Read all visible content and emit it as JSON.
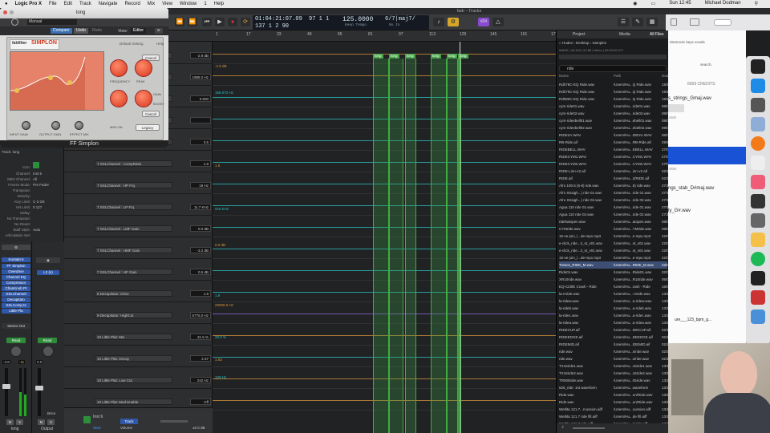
{
  "menubar": {
    "apple": "",
    "items": [
      "Logic Pro X",
      "File",
      "Edit",
      "Track",
      "Navigate",
      "Record",
      "Mix",
      "View",
      "Window",
      "1",
      "Help"
    ],
    "clock": "Sun 12:45",
    "user": "Michael Dodman"
  },
  "window_title": "fadr - Tracks",
  "transport": {
    "position": "01:04:21:07.09",
    "bars": "137  1  2  90",
    "tempo_top": "97  1  1",
    "tempo_bottom": "125.0000",
    "keep_tempo": "Keep Tempo",
    "sig": "6/7|maj7/",
    "sig2": "No In",
    "cpu": "d34",
    "time_label": "1234"
  },
  "plugin": {
    "title": "long",
    "preset": "Manual",
    "compare": "Compare",
    "undo": "Undo",
    "redo": "Redo",
    "view_label": "View:",
    "view_value": "Editor",
    "brand": "fabfilter",
    "product": "SIMPLON",
    "default_setting": "Default Setting",
    "help": "Help",
    "cancel": "Cancel",
    "frequency": "FREQUENCY",
    "peak": "PEAK",
    "gain": "GAIN",
    "boost": "BOOST",
    "input_gain": "INPUT GAIN",
    "output_gain": "OUTPUT GAIN",
    "effect_mix": "EFFECT MIX",
    "midi_on": "MIDI ON",
    "legacy": "Legacy",
    "footer_name": "FF Simplon"
  },
  "inspector": {
    "track_label": "Track:",
    "track_name": "long",
    "icon_label": "Icon:",
    "rows": [
      [
        "Channel:",
        "Inst 5"
      ],
      [
        "MIDI Channel:",
        "All"
      ],
      [
        "Freeze Mode:",
        "Pre Fader"
      ],
      [
        "Transpose:",
        ""
      ],
      [
        "Velocity:",
        ""
      ],
      [
        "Key Limit:",
        "C-2  G8"
      ],
      [
        "Vel Limit:",
        "0  127"
      ],
      [
        "Delay:",
        ""
      ],
      [
        "No Transpose:",
        ""
      ],
      [
        "No Reset:",
        ""
      ],
      [
        "Staff Style:",
        "Auto"
      ],
      [
        "Articulation Set:",
        ""
      ]
    ],
    "strip1": {
      "plugins": [
        "Kontakt 5",
        "FF Simplon",
        "Overdrive",
        "Channel EQ",
        "Compressor",
        "ChanKnob Pr",
        "SSLChannel",
        "Decapitato",
        "SSLComp.ts",
        "Little Pla"
      ],
      "output": "Stereo Out",
      "read": "Read",
      "val1": "-4.8",
      "val2": "-11",
      "m": "M",
      "s": "S",
      "name": "long"
    },
    "strip2": {
      "plugins": [
        "L2 (s)"
      ],
      "read": "Read",
      "val1": "0.0",
      "m": "M",
      "s": "S",
      "name": "Output",
      "bnce": "Bnce"
    }
  },
  "tracks": [
    {
      "name": "",
      "value": "-2.9 dB"
    },
    {
      "name": "",
      "value": "1988.2 Hz"
    },
    {
      "name": "",
      "value": "0.600"
    },
    {
      "name": "",
      "value": ""
    },
    {
      "name": "",
      "value": "3.5"
    },
    {
      "name": "7 SSLChannel : CompRatio",
      "value": "1.8"
    },
    {
      "name": "7 SSLChannel : HP Frq",
      "value": "18 Hz"
    },
    {
      "name": "7 SSLChannel : LP Frq",
      "value": "11.7 KHz"
    },
    {
      "name": "7 SSLChannel : LMF Gain",
      "value": "0.0 dB"
    },
    {
      "name": "7 SSLChannel : HMF Gain",
      "value": "-3.2 dB"
    },
    {
      "name": "7 SSLChannel : HF Gain",
      "value": "0.5 dB"
    },
    {
      "name": "8 Decapitator: Drive",
      "value": "1.8"
    },
    {
      "name": "9 Decapitator: HighCut",
      "value": "5775.0 Hz"
    },
    {
      "name": "10 Little Plat: Mix",
      "value": "31.5 %"
    },
    {
      "name": "10 Little Plat: Decay",
      "value": "2.37"
    },
    {
      "name": "10 Little Plat: Low Cut",
      "value": "242 Hz"
    },
    {
      "name": "10 Little Plat: Mod Enable",
      "value": "Off"
    }
  ],
  "bottom_track": {
    "name": "Inst 6",
    "volume": "Volume",
    "value": "±0.0 dB",
    "track_btn": "Track",
    "start": "Start"
  },
  "ruler": [
    "1",
    "17",
    "33",
    "49",
    "65",
    "81",
    "97",
    "113",
    "129",
    "145",
    "161",
    "177"
  ],
  "regions": [
    "long",
    "long",
    "long",
    "long",
    "long",
    "long"
  ],
  "lane_labels": [
    "-2.9 dB",
    "165.072 Hz",
    "1.8",
    "Out KHz",
    "0.0 dB",
    "1.8",
    "20000.0 Hz",
    "29.0 %",
    "1.63",
    "129 Hz"
  ],
  "browser": {
    "tabs": [
      "Project",
      "Media",
      "All Files"
    ],
    "path": [
      "Hudex",
      "Desktop",
      "Samples"
    ],
    "info": "WAVE | 44,100 | 24 Bit | Mono | 00:00:00.577",
    "search": "ride",
    "cols": [
      "Name",
      "Path",
      "Date"
    ],
    "rows": [
      [
        "Rd078C-EQ Ride.wav",
        "/Users/Hu...Q Ride.wav",
        "19/10/20..."
      ],
      [
        "Rd079C-EQ Ride.wav",
        "/Users/Hu...Q Ride.wav",
        "19/10/20..."
      ],
      [
        "Rd080C-EQ Ride.wav",
        "/Users/Hu...Q Ride.wav",
        "19/10/20..."
      ],
      [
        "cym-ride01.wav",
        "/Users/Hu...ride01.wav",
        "08/05/20..."
      ],
      [
        "cym-ride02.wav",
        "/Users/Hu...ride02.wav",
        "08/05/20..."
      ],
      [
        "cym-rideebell01.wav",
        "/Users/Hu...ebell01.wav",
        "08/05/20..."
      ],
      [
        "cym-rideebell02.wav",
        "/Users/Hu...ebell02.wav",
        "08/05/20..."
      ],
      [
        "RIDE2A.WAV",
        "/Users/Hu...IDE2A.WAV",
        "06/04/20..."
      ],
      [
        "RB-Ride.aif",
        "/Users/Hu...RB-Ride.aif",
        "29/12/19..."
      ],
      [
        "RIDEBELL.WAV",
        "/Users/Hu...EBELL.WAV",
        "27/04/19..."
      ],
      [
        "RIDECYM1.WAV",
        "/Users/Hu...CYM1.WAV",
        "27/04/19..."
      ],
      [
        "RIDECYM2.WAV",
        "/Users/Hu...CYM2.WAV",
        "27/04/19..."
      ],
      [
        "RIDE-Linn-v2.aif",
        "/Users/Hu...inn-v2.aif",
        "02/10/20..."
      ],
      [
        "RIDE.aif",
        "/Users/Hu...2/RIDE.aif",
        "02/10/20..."
      ],
      [
        "Afro 100.5 (6-8) ride.wav",
        "/Users/Hu...8) ride.wav",
        "27/10/20..."
      ],
      [
        "Afro Straigh...) ride 01.wav",
        "/Users/Hu...ride 01.wav",
        "27/10/20..."
      ],
      [
        "Afro Straigh...) ride 02.wav",
        "/Users/Hu...ride 02.wav",
        "27/10/20..."
      ],
      [
        "Agua 110 ride 01.wav",
        "/Users/Hu...ride 01.wav",
        "27/10/20..."
      ],
      [
        "Agua 110 ride 02.wav",
        "/Users/Hu...ride 02.wav",
        "27/10/20..."
      ],
      [
        "ridehatopen.wav",
        "/Users/Hu...atopen.wav",
        "08/03/20..."
      ],
      [
        "CYMride.wav",
        "/Users/Hu...YMride.wav",
        "08/03/20..."
      ],
      [
        "15-ve-join_l...de-mpx.mp3",
        "/Users/Hu...e-mpx.mp3",
        "22/08/20..."
      ],
      [
        "e-click_ride...2_st_v01.wav",
        "/Users/Hu...st_v01.wav",
        "22/08/20..."
      ],
      [
        "e-click_ride...3_st_v01.wav",
        "/Users/Hu...st_v01.wav",
        "22/08/20..."
      ],
      [
        "15-ve-join_l...de-mpx.mp3",
        "/Users/Hu...e-mpx.mp3",
        "22/08/20..."
      ],
      [
        "Trance_RIDE_M.wav",
        "/Users/Hu...RIDE_M.wav",
        "22/08/20..."
      ],
      [
        "Ride01.wav",
        "/Users/Hu...Ride01.wav",
        "02/01/19..."
      ],
      [
        "XR10ride.wav",
        "/Users/Hu...R10ride.wav",
        "05/06/20..."
      ],
      [
        "EQ-Cid0E Crash - Ride",
        "/Users/Hu...rash - Ride",
        "16/03/20..."
      ],
      [
        "la-mride.wav",
        "/Users/Hu...-mride.wav",
        "13/12/199..."
      ],
      [
        "la-ridew.wav",
        "/Users/Hu...a-ridew.wav",
        "13/12/199..."
      ],
      [
        "la-rideb.wav",
        "/Users/Hu...a-rideb.wav",
        "13/12/199..."
      ],
      [
        "la-ridec.wav",
        "/Users/Hu...a-ridec.wav",
        "13/12/199..."
      ],
      [
        "la-ridea.wav",
        "/Users/Hu...a-ridea.wav",
        "13/12/199..."
      ],
      [
        "RIDECUP.aif",
        "/Users/Hu...IDECUP.aif",
        "02/10/20..."
      ],
      [
        "RIDEEDGE.aif",
        "/Users/Hu...DEEDGE.aif",
        "02/10/20..."
      ],
      [
        "RIDEMID.aif",
        "/Users/Hu...IDEMID.aif",
        "02/10/20..."
      ],
      [
        "ride.wav",
        "/Users/Hu...s/ride.wav",
        "02/10/20..."
      ],
      [
        "ride.wav",
        "/Users/Hu...s/ride.wav",
        "02/10/20..."
      ],
      [
        "TX16ride1.wav",
        "/Users/Hu...16ride1.wav",
        "13/12/199..."
      ],
      [
        "TX16ride2.wav",
        "/Users/Hu...16ride2.wav",
        "13/12/199..."
      ],
      [
        "TR505ride.wav",
        "/Users/Hu...05ride.wav",
        "13/12/199..."
      ],
      [
        "626_ride: 1st waveform",
        "/Users/Hu...waveform",
        "13/12/199..."
      ],
      [
        "Ride.wav",
        "/Users/Hu...on/Ride.wav",
        "13/12/199..."
      ],
      [
        "Ride.wav",
        "/Users/Hu...on/Ride.wav",
        "13/12/199..."
      ],
      [
        "Wetlita 121.7...rcussion.aiff",
        "/Users/Hu...cussion.aiff",
        "13/12/199..."
      ],
      [
        "Wetlita 121.7 ride fill.aiff",
        "/Users/Hu...de fill.aiff",
        "13/12/199..."
      ],
      [
        "Wetlita 121.7 ride.aiff",
        "/Users/Hu...7 ride.aiff",
        "13/12/199..."
      ]
    ],
    "selected_index": 25
  },
  "rightwin": {
    "tabs": "electronic  keys  vocals",
    "search": "search.",
    "credits": "6659 CREDITS",
    "items": [
      "s_strings_Gmaj.wav",
      "ngs_stab_D#maj.wav",
      "ly_G#.wav",
      "ure___123_bpm_g..."
    ],
    "wav": ".wav"
  },
  "colors": {
    "accent": "#3b8cd9",
    "lane_cyan": "#2bc6c6",
    "lane_orange": "#d9973b",
    "lane_purple": "#8f6ae0",
    "region": "#4aa54a",
    "knob": "#d6361b"
  }
}
